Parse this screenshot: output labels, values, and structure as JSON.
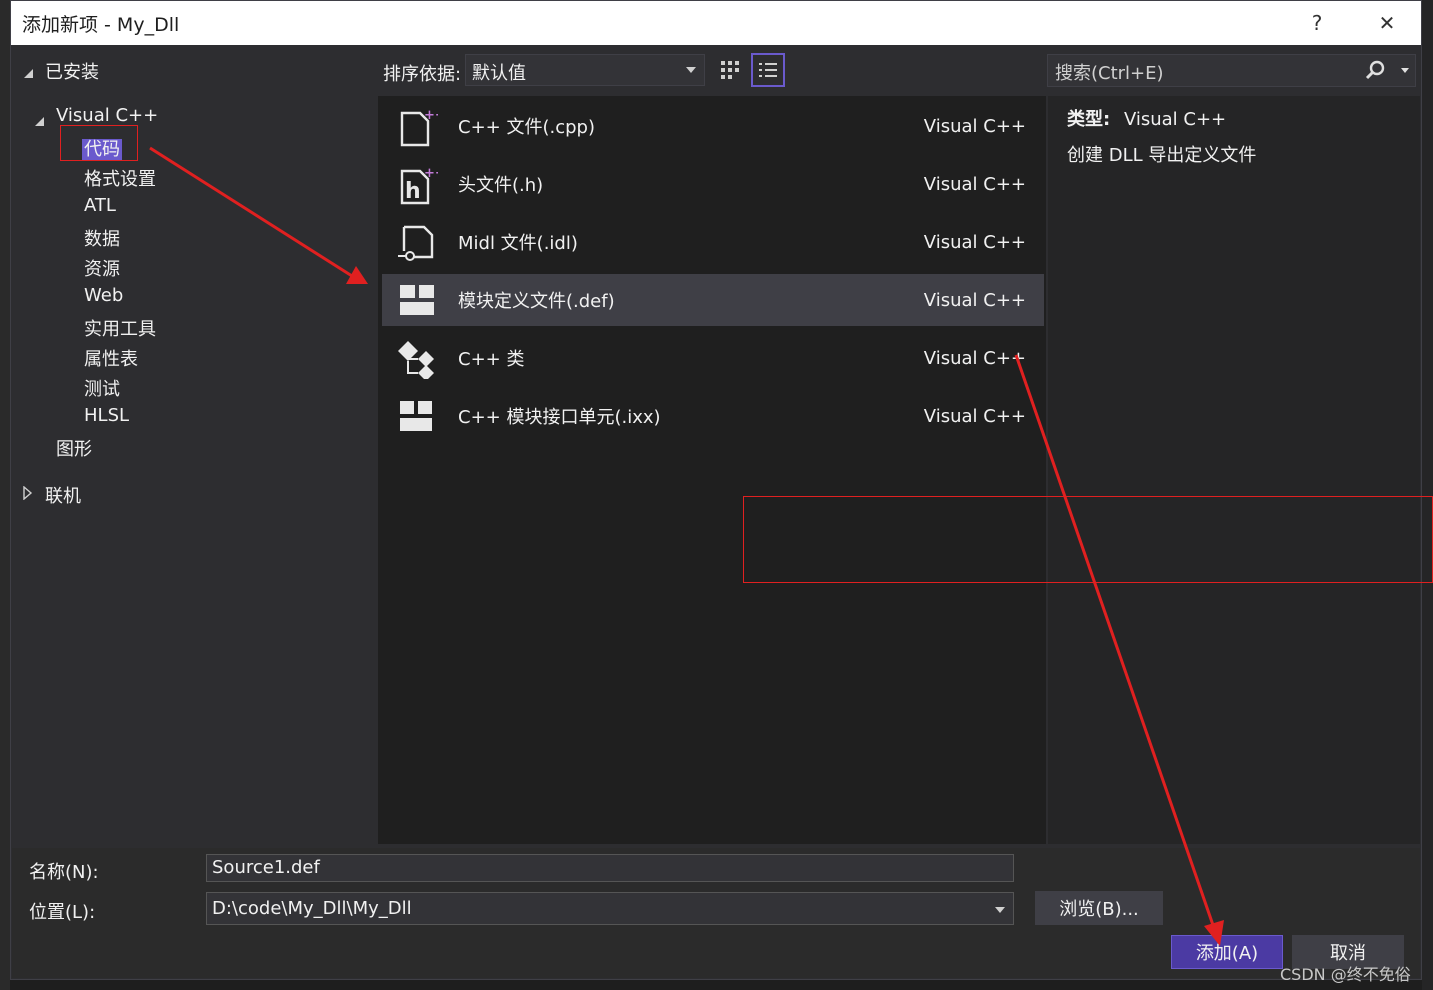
{
  "window": {
    "title": "添加新项 - My_Dll",
    "help_label": "?",
    "close_label": "✕"
  },
  "tree": {
    "installed_label": "已安装",
    "visual_cpp_label": "Visual C++",
    "items": [
      "代码",
      "格式设置",
      "ATL",
      "数据",
      "资源",
      "Web",
      "实用工具",
      "属性表",
      "测试",
      "HLSL"
    ],
    "graphics_label": "图形",
    "online_label": "联机",
    "selected_item": "代码"
  },
  "toolbar": {
    "sort_label": "排序依据:",
    "sort_value": "默认值",
    "search_placeholder": "搜索(Ctrl+E)"
  },
  "templates": [
    {
      "name": "C++ 文件(.cpp)",
      "lang": "Visual C++",
      "icon": "cpp-file-icon",
      "selected": false
    },
    {
      "name": "头文件(.h)",
      "lang": "Visual C++",
      "icon": "header-file-icon",
      "selected": false
    },
    {
      "name": "Midl 文件(.idl)",
      "lang": "Visual C++",
      "icon": "midl-file-icon",
      "selected": false
    },
    {
      "name": "模块定义文件(.def)",
      "lang": "Visual C++",
      "icon": "module-definition-icon",
      "selected": true
    },
    {
      "name": "C++ 类",
      "lang": "Visual C++",
      "icon": "cpp-class-icon",
      "selected": false
    },
    {
      "name": "C++ 模块接口单元(.ixx)",
      "lang": "Visual C++",
      "icon": "module-interface-icon",
      "selected": false
    }
  ],
  "details": {
    "type_label": "类型:",
    "type_value": "Visual C++",
    "description": "创建 DLL 导出定义文件"
  },
  "form": {
    "name_label": "名称(N):",
    "name_value": "Source1.def",
    "location_label": "位置(L):",
    "location_value": "D:\\code\\My_Dll\\My_Dll",
    "browse_label": "浏览(B)...",
    "add_label": "添加(A)",
    "cancel_label": "取消"
  },
  "watermark": "CSDN @终不免俗",
  "colors": {
    "accent": "#6a5acd",
    "annotation": "#e02020",
    "background": "#2d2d30"
  }
}
